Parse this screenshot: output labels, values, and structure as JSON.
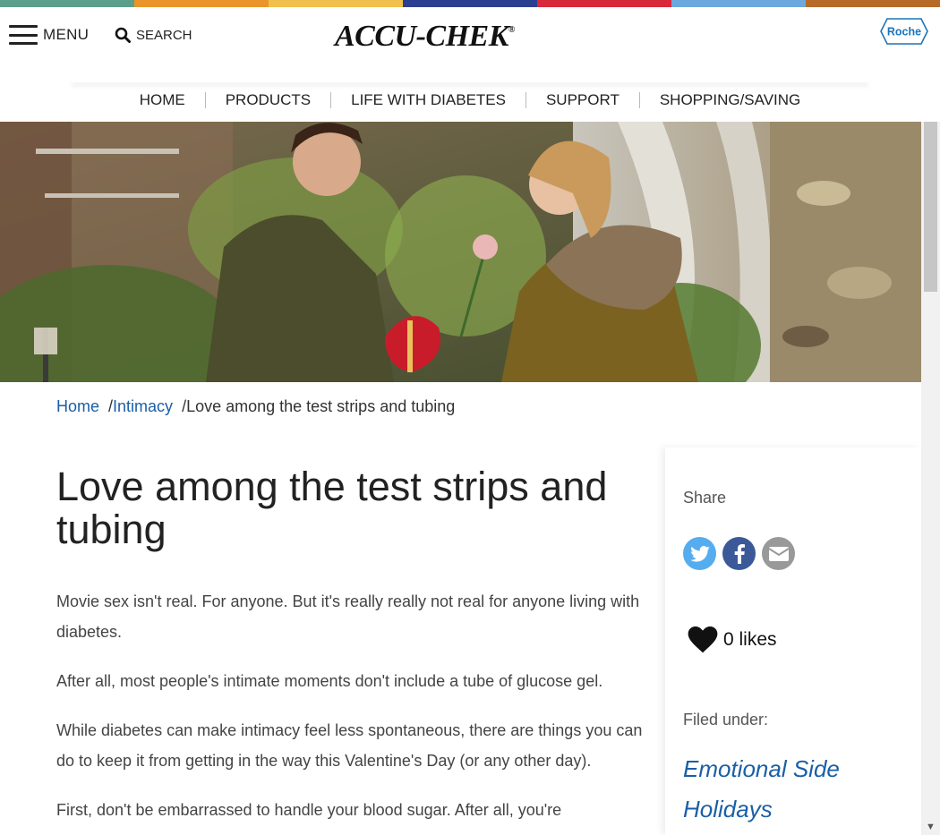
{
  "colors": {
    "top_bar": [
      "#5b9e8c",
      "#e9952b",
      "#f0c04d",
      "#2a3f8f",
      "#d8293b",
      "#6ca8de",
      "#b56a2a"
    ],
    "link": "#1a5fa6",
    "roche_blue": "#1c74bc",
    "twitter": "#55acee",
    "facebook": "#3b5998",
    "email": "#999999"
  },
  "header": {
    "menu_label": "MENU",
    "search_label": "SEARCH",
    "logo_text": "ACCU-CHEK",
    "logo_mark": "®",
    "roche_label": "Roche"
  },
  "nav": {
    "items": [
      "HOME",
      "PRODUCTS",
      "LIFE WITH DIABETES",
      "SUPPORT",
      "SHOPPING/SAVING"
    ]
  },
  "breadcrumb": {
    "home": "Home",
    "sep1": "/",
    "category": "Intimacy",
    "sep2": "/",
    "current": "Love among the test strips and tubing"
  },
  "article": {
    "title": "Love among the test strips and tubing",
    "paragraphs": [
      "Movie sex isn't real. For anyone. But it's really really not real for anyone living with diabetes.",
      "After all, most people's intimate moments don't include a tube of glucose gel.",
      "While diabetes can make intimacy feel less spontaneous, there are things you can do to keep it from getting in the way this Valentine's Day (or any other day).",
      "First, don't be embarrassed to handle your blood sugar. After all, you're"
    ]
  },
  "sidebar": {
    "share_label": "Share",
    "social_icons": [
      "twitter-icon",
      "facebook-icon",
      "email-icon"
    ],
    "likes_label": "0 likes",
    "filed_label": "Filed under:",
    "tags": [
      "Emotional Side",
      "Holidays"
    ]
  }
}
